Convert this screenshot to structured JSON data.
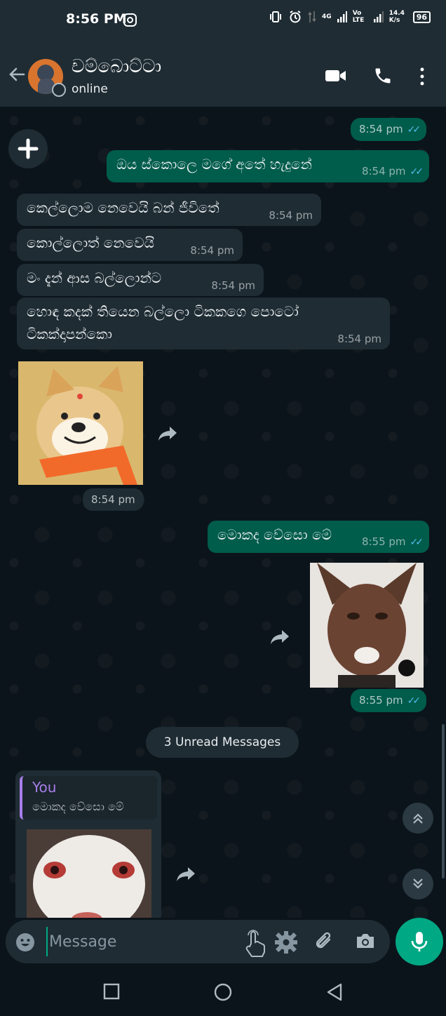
{
  "status_bar": {
    "time": "8:56 PM",
    "network_4g": "4G",
    "volte": "Vo LTE",
    "speed": "14.4 K/s",
    "battery": "96"
  },
  "header": {
    "contact_name": "චම්බොට්ටා",
    "status": "online"
  },
  "messages": [
    {
      "text": "",
      "time": "8:54 pm",
      "direction": "out"
    },
    {
      "text": "ඔය ස්කොලෙ මගේ අතේ හැදුනේ",
      "time": "8:54 pm",
      "direction": "out"
    },
    {
      "text": "කෙල්ලොම නෙවෙයි බන් ජීවිතේ",
      "time": "8:54 pm",
      "direction": "in"
    },
    {
      "text": "කොල්ලොත් නෙවෙයි",
      "time": "8:54 pm",
      "direction": "in"
    },
    {
      "text": "මං දැන් ආස බල්ලොන්ට",
      "time": "8:54 pm",
      "direction": "in"
    },
    {
      "text": "හොඳ කදක් තියෙන බල්ලො ටිකකගෙ පොටෝ ටිකක්දාපන්කො",
      "time": "8:54 pm",
      "direction": "in"
    },
    {
      "text": "",
      "time": "8:54 pm",
      "direction": "in",
      "image": "doge-scarf"
    },
    {
      "text": "මොකද වේසො මේ",
      "time": "8:55 pm",
      "direction": "out"
    },
    {
      "text": "",
      "time": "8:55 pm",
      "direction": "out",
      "image": "dog-ears-face"
    }
  ],
  "unread": "3 Unread Messages",
  "reply": {
    "author": "You",
    "quoted_text": "මොකද වේසො මේ"
  },
  "input": {
    "placeholder": "Message"
  },
  "colors": {
    "out_bubble": "#005c4b",
    "in_bubble": "#1f2c34",
    "accent": "#00a884",
    "ticks": "#53bdeb",
    "quote_accent": "#a77ee8"
  }
}
